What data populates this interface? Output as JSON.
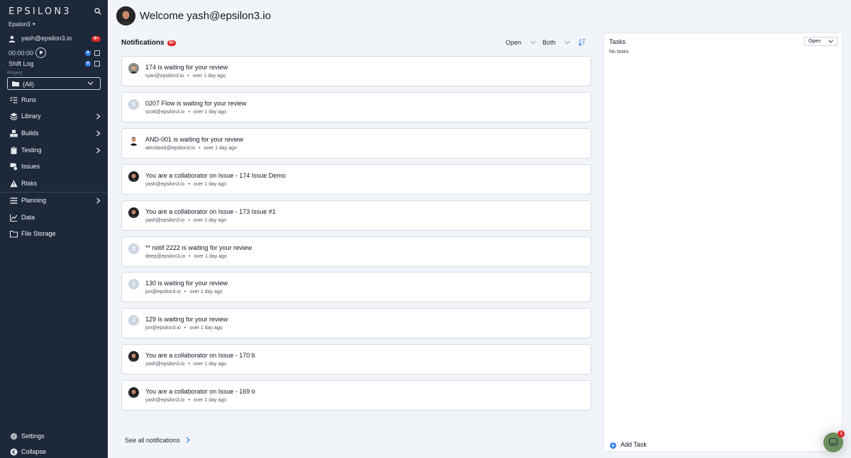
{
  "sidebar": {
    "logo": "EPSILON3",
    "org": "Epsilon3",
    "user_email": "yash@epsilon3.io",
    "user_badge": "9+",
    "timer": "00:00:00",
    "shift_log": "Shift Log",
    "project_label": "Project",
    "project_value": "(All)",
    "nav": [
      {
        "label": "Runs",
        "icon": "runs-list-icon",
        "has_arrow": false
      },
      {
        "label": "Library",
        "icon": "library-stack-icon",
        "has_arrow": true
      },
      {
        "label": "Builds",
        "icon": "builds-cubes-icon",
        "has_arrow": true
      },
      {
        "label": "Testing",
        "icon": "testing-clipboard-icon",
        "has_arrow": true
      },
      {
        "label": "Issues",
        "icon": "issues-icon",
        "has_arrow": false
      },
      {
        "label": "Risks",
        "icon": "risks-warning-icon",
        "has_arrow": false
      },
      {
        "label": "Planning",
        "icon": "planning-icon",
        "has_arrow": true
      },
      {
        "label": "Data",
        "icon": "data-chart-icon",
        "has_arrow": false
      },
      {
        "label": "File Storage",
        "icon": "folder-icon",
        "has_arrow": false
      }
    ],
    "settings": "Settings",
    "collapse": "Collapse"
  },
  "header": {
    "welcome": "Welcome yash@epsilon3.io"
  },
  "notifications": {
    "title": "Notifications",
    "badge": "9+",
    "filter_status": "Open",
    "filter_scope": "Both",
    "items": [
      {
        "title": "174 is waiting for your review",
        "email": "ryan@epsilon3.io",
        "time": "over 1 day ago",
        "avatar": "photo-ryan",
        "letter": ""
      },
      {
        "title": "0207 Flow is waiting for your review",
        "email": "scott@epsilon3.io",
        "time": "over 1 day ago",
        "avatar": "letter",
        "letter": "S"
      },
      {
        "title": "AND-001 is waiting for your review",
        "email": "alecdavid@epsilon3.io",
        "time": "over 1 day ago",
        "avatar": "photo-alec",
        "letter": ""
      },
      {
        "title": "You are a collaborator on Issue - 174 Issue Demo",
        "email": "yash@epsilon3.io",
        "time": "over 1 day ago",
        "avatar": "photo-yash",
        "letter": ""
      },
      {
        "title": "You are a collaborator on Issue - 173 Issue #1",
        "email": "yash@epsilon3.io",
        "time": "over 1 day ago",
        "avatar": "photo-yash",
        "letter": ""
      },
      {
        "title": "** notif 2222 is waiting for your review",
        "email": "deep@epsilon3.io",
        "time": "over 1 day ago",
        "avatar": "letter",
        "letter": "D"
      },
      {
        "title": "130 is waiting for your review",
        "email": "jon@epsilon3.io",
        "time": "over 1 day ago",
        "avatar": "letter",
        "letter": "J"
      },
      {
        "title": "129 is waiting for your review",
        "email": "jon@epsilon3.io",
        "time": "over 1 day ago",
        "avatar": "letter",
        "letter": "J"
      },
      {
        "title": "You are a collaborator on Issue - 170 b",
        "email": "yash@epsilon3.io",
        "time": "over 1 day ago",
        "avatar": "photo-yash",
        "letter": ""
      },
      {
        "title": "You are a collaborator on Issue - 169 b",
        "email": "yash@epsilon3.io",
        "time": "over 1 day ago",
        "avatar": "photo-yash",
        "letter": ""
      }
    ],
    "see_all": "See all notifications"
  },
  "tasks": {
    "title": "Tasks",
    "filter": "Open",
    "empty": "No tasks",
    "add_task": "Add Task"
  },
  "chat": {
    "badge": "1"
  },
  "colors": {
    "sidebar_bg": "#1d283a",
    "page_bg": "#f1f4f9",
    "accent_blue": "#3b82f6",
    "badge_red": "#dc2626",
    "chat_green": "#6b8f5e"
  }
}
